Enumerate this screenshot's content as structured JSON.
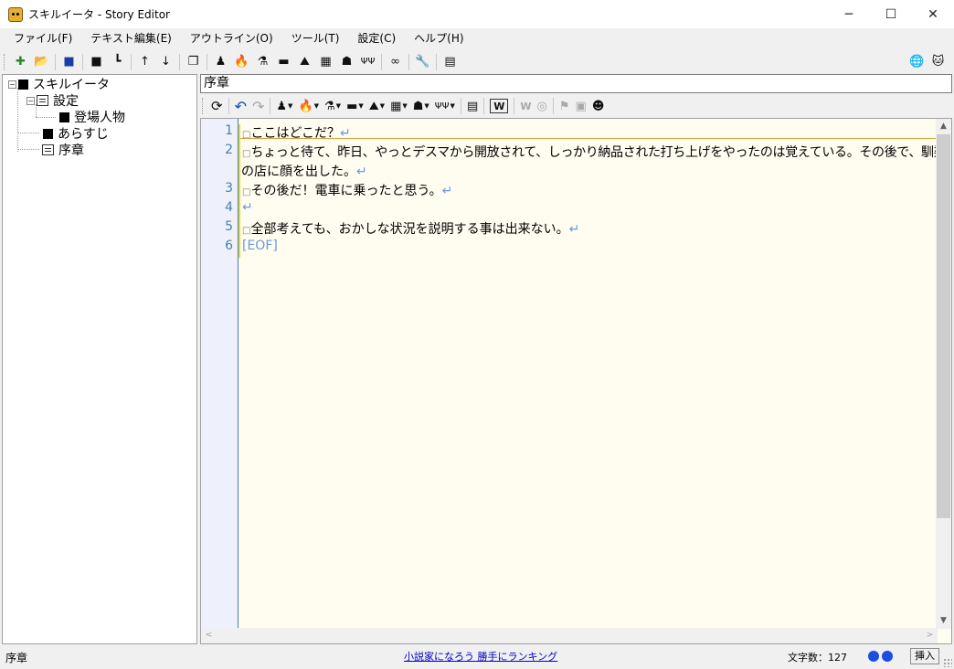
{
  "window": {
    "title": "スキルイータ - Story Editor",
    "minimize_glyph": "─",
    "maximize_glyph": "☐",
    "close_glyph": "✕"
  },
  "menu": [
    {
      "label": "ファイル(F)"
    },
    {
      "label": "テキスト編集(E)"
    },
    {
      "label": "アウトライン(O)"
    },
    {
      "label": "ツール(T)"
    },
    {
      "label": "設定(C)"
    },
    {
      "label": "ヘルプ(H)"
    }
  ],
  "toolbar1": {
    "icons": [
      "new-item-icon",
      "open-folder-icon",
      "save-icon",
      "square-icon",
      "indent-icon",
      "move-up-icon",
      "move-down-icon",
      "window-icon",
      "character-icon",
      "fire-icon",
      "flask-icon",
      "briefcase-icon",
      "landscape-icon",
      "building-icon",
      "creature-icon",
      "tools-icon",
      "binoculars-icon",
      "wrench-icon",
      "document-settings-icon"
    ],
    "glyphs": {
      "new": "✚",
      "open": "📂",
      "save": "■",
      "square": "■",
      "indent": "┗",
      "up": "↑",
      "down": "↓",
      "window": "❐",
      "character": "♟",
      "fire": "🔥",
      "flask": "⚗",
      "briefcase": "▬",
      "landscape": "⛰",
      "building": "▦",
      "creature": "☗",
      "tools": "ΨΨ",
      "binoculars": "∞",
      "wrench": "🔧",
      "docset": "▤",
      "globe": "🌐",
      "cat": "🐱"
    }
  },
  "tree": {
    "root": "スキルイータ",
    "settings": "設定",
    "characters": "登場人物",
    "synopsis": "あらすじ",
    "prologue": "序章",
    "expander_open": "−"
  },
  "document": {
    "title": "序章"
  },
  "toolbar2": {
    "glyphs": {
      "refresh": "⟳",
      "undo": "↶",
      "redo": "↷",
      "character": "♟",
      "fire": "🔥",
      "flask": "⚗",
      "briefcase": "▬",
      "landscape": "⛰",
      "building": "▦",
      "creature": "☗",
      "tools": "ΨΨ",
      "doc": "▤",
      "word": "W",
      "word_dim": "W",
      "globe_dim": "◎",
      "flag_dim": "⚑",
      "book_dim": "▣",
      "person": "☻",
      "dropdown": "▼"
    }
  },
  "editor": {
    "line_numbers": [
      "1",
      "2",
      "3",
      "4",
      "5",
      "6"
    ],
    "lines": [
      "ここはどこだ？",
      "ちょっと待て、昨日、やっとデスマから開放されて、しっかり納品された打ち上げをやったのは覚えている。その後で、馴染み",
      "の店に顔を出した。",
      "その後だ！電車に乗ったと思う。",
      "",
      "全部考えても、おかしな状況を説明する事は出来ない。"
    ],
    "space_marker": "□",
    "eol_marker": "↵",
    "eof_marker": "[EOF]",
    "scroll_up": "▲",
    "scroll_down": "▼",
    "scroll_left": "<",
    "scroll_right": ">"
  },
  "status": {
    "left": "序章",
    "link": "小説家になろう 勝手にランキング",
    "char_count": "文字数：127",
    "mode": "挿入"
  },
  "colors": {
    "dot": "#1a4ee0",
    "link": "#0000cc",
    "gutter_text": "#4a7fa8"
  }
}
